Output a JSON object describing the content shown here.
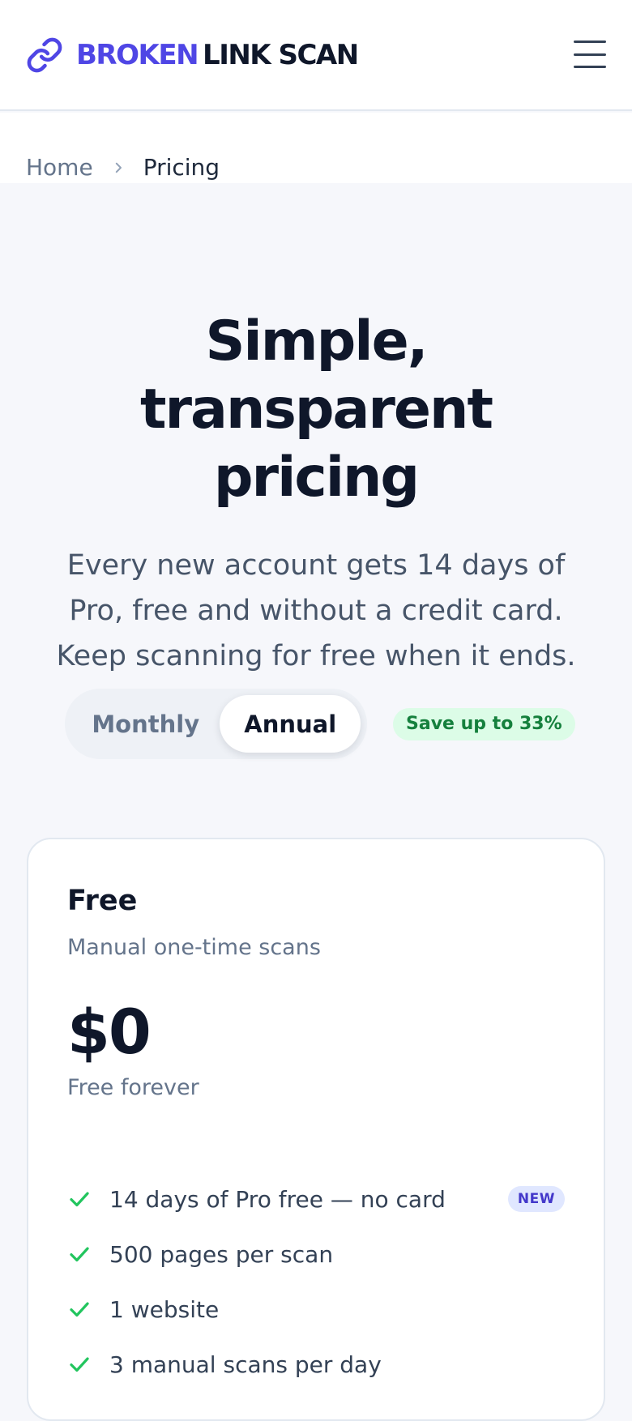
{
  "brand": {
    "name_part1": "BROKEN",
    "name_part2": "LINK SCAN"
  },
  "icons": {
    "logo": "link-icon",
    "menu": "hamburger-menu-icon",
    "breadcrumb_separator": "chevron-right-icon",
    "feature_bullet": "check-icon"
  },
  "colors": {
    "brand": "#4f46e5",
    "heading": "#0f172a",
    "muted": "#64748b",
    "success": "#22c55e",
    "badge_new_bg": "#e0e7ff"
  },
  "breadcrumb": {
    "home": "Home",
    "current": "Pricing"
  },
  "hero": {
    "title": "Simple, transparent pricing",
    "subtitle": "Every new account gets 14 days of Pro, free and without a credit card. Keep scanning for free when it ends."
  },
  "billing_toggle": {
    "monthly": "Monthly",
    "annual": "Annual",
    "selected": "Annual",
    "savings_badge": "Save up to 33%"
  },
  "plan": {
    "name": "Free",
    "description": "Manual one-time scans",
    "price": "$0",
    "period": "Free forever",
    "features": [
      {
        "text": "14 days of Pro free — no card",
        "badge": "NEW"
      },
      {
        "text": "500 pages per scan"
      },
      {
        "text": "1 website"
      },
      {
        "text": "3 manual scans per day"
      }
    ]
  }
}
